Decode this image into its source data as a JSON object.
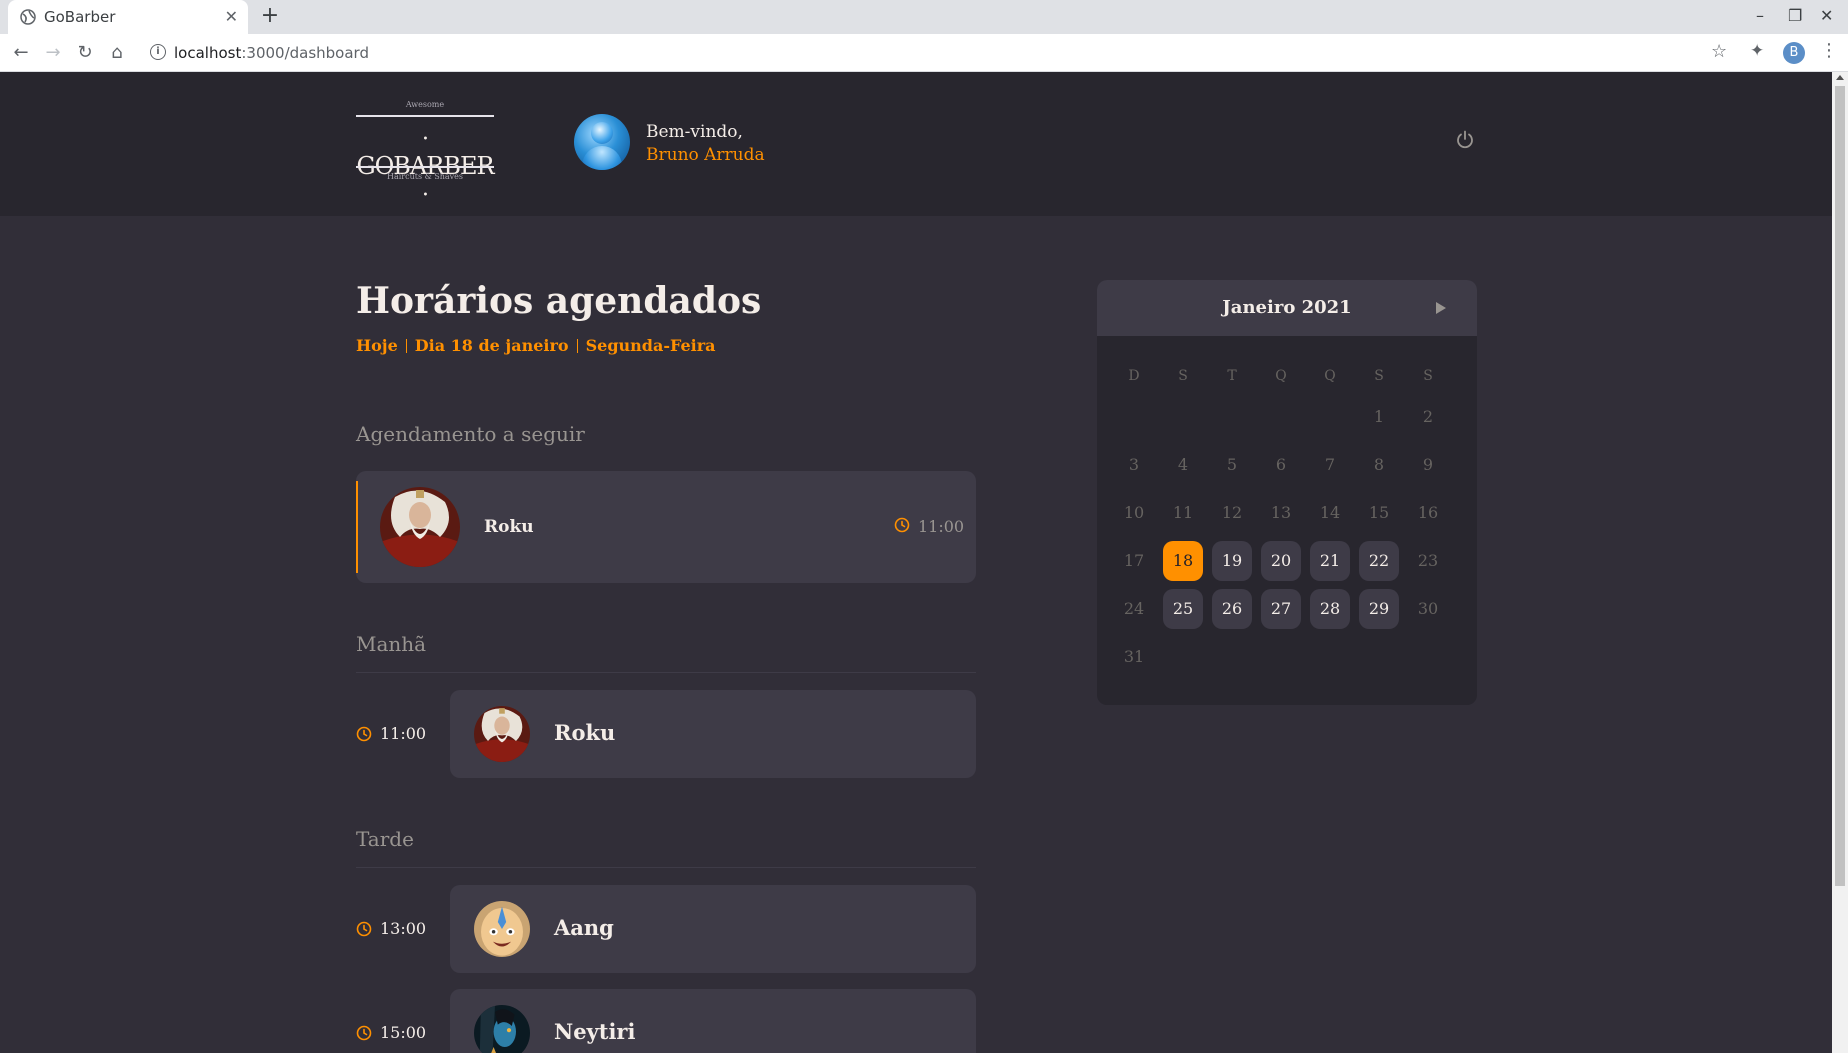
{
  "browser": {
    "tab_title": "GoBarber",
    "url_host": "localhost",
    "url_rest": ":3000/dashboard",
    "profile_initial": "B"
  },
  "header": {
    "logo_top": "Awesome",
    "logo_name": "GOBARBER",
    "logo_sub": "Haircuts & Shaves",
    "welcome": "Bem-vindo,",
    "user_name": "Bruno Arruda"
  },
  "schedule": {
    "title": "Horários agendados",
    "today": "Hoje",
    "date": "Dia 18 de janeiro",
    "weekday": "Segunda-Feira",
    "next_heading": "Agendamento a seguir",
    "next": {
      "name": "Roku",
      "time": "11:00"
    },
    "morning_heading": "Manhã",
    "morning": [
      {
        "time": "11:00",
        "name": "Roku"
      }
    ],
    "afternoon_heading": "Tarde",
    "afternoon": [
      {
        "time": "13:00",
        "name": "Aang"
      },
      {
        "time": "15:00",
        "name": "Neytiri"
      }
    ]
  },
  "calendar": {
    "month_label": "Janeiro 2021",
    "weekdays": [
      "D",
      "S",
      "T",
      "Q",
      "Q",
      "S",
      "S"
    ],
    "first_weekday": 5,
    "days_in_month": 31,
    "selected_day": 18,
    "available_days": [
      18,
      19,
      20,
      21,
      22,
      25,
      26,
      27,
      28,
      29
    ]
  },
  "colors": {
    "accent": "#ff9000",
    "background": "#312e38",
    "header_bg": "#28262e",
    "card_bg": "#3e3b47"
  }
}
